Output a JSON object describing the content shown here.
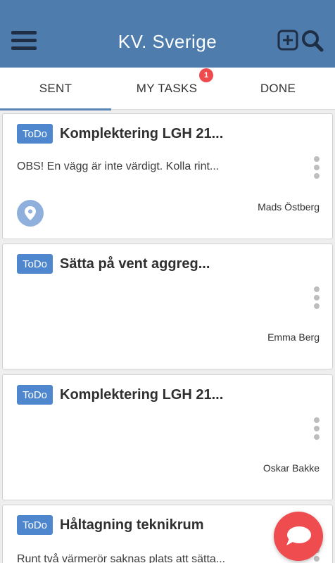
{
  "header": {
    "title": "KV. Sverige",
    "bar_color": "#4d7cad",
    "icons": [
      "menu-icon",
      "add-square-icon",
      "search-icon"
    ]
  },
  "tabs": [
    {
      "label": "SENT",
      "active": true
    },
    {
      "label": "MY TASKS",
      "active": false,
      "badge": "1"
    },
    {
      "label": "DONE",
      "active": false
    }
  ],
  "tasks": [
    {
      "tag": "ToDo",
      "title": "Komplektering LGH 21...",
      "description": "OBS! En vägg är inte värdigt. Kolla rint...",
      "assignee": "Mads Östberg",
      "has_location": true
    },
    {
      "tag": "ToDo",
      "title": "Sätta på vent aggreg...",
      "description": "",
      "assignee": "Emma Berg",
      "has_location": false
    },
    {
      "tag": "ToDo",
      "title": "Komplektering LGH 21...",
      "description": "",
      "assignee": "Oskar Bakke",
      "has_location": false
    },
    {
      "tag": "ToDo",
      "title": "Håltagning teknikrum",
      "description": "Runt två värmerör saknas plats att sätta...",
      "assignee": "",
      "has_location": false
    }
  ],
  "fab": {
    "icon": "chat-bubble-icon",
    "color": "#ef4c4f"
  },
  "colors": {
    "tag": "#4f87cf",
    "badge": "#ee4b4f",
    "tab_indicator": "#5b87b8"
  }
}
